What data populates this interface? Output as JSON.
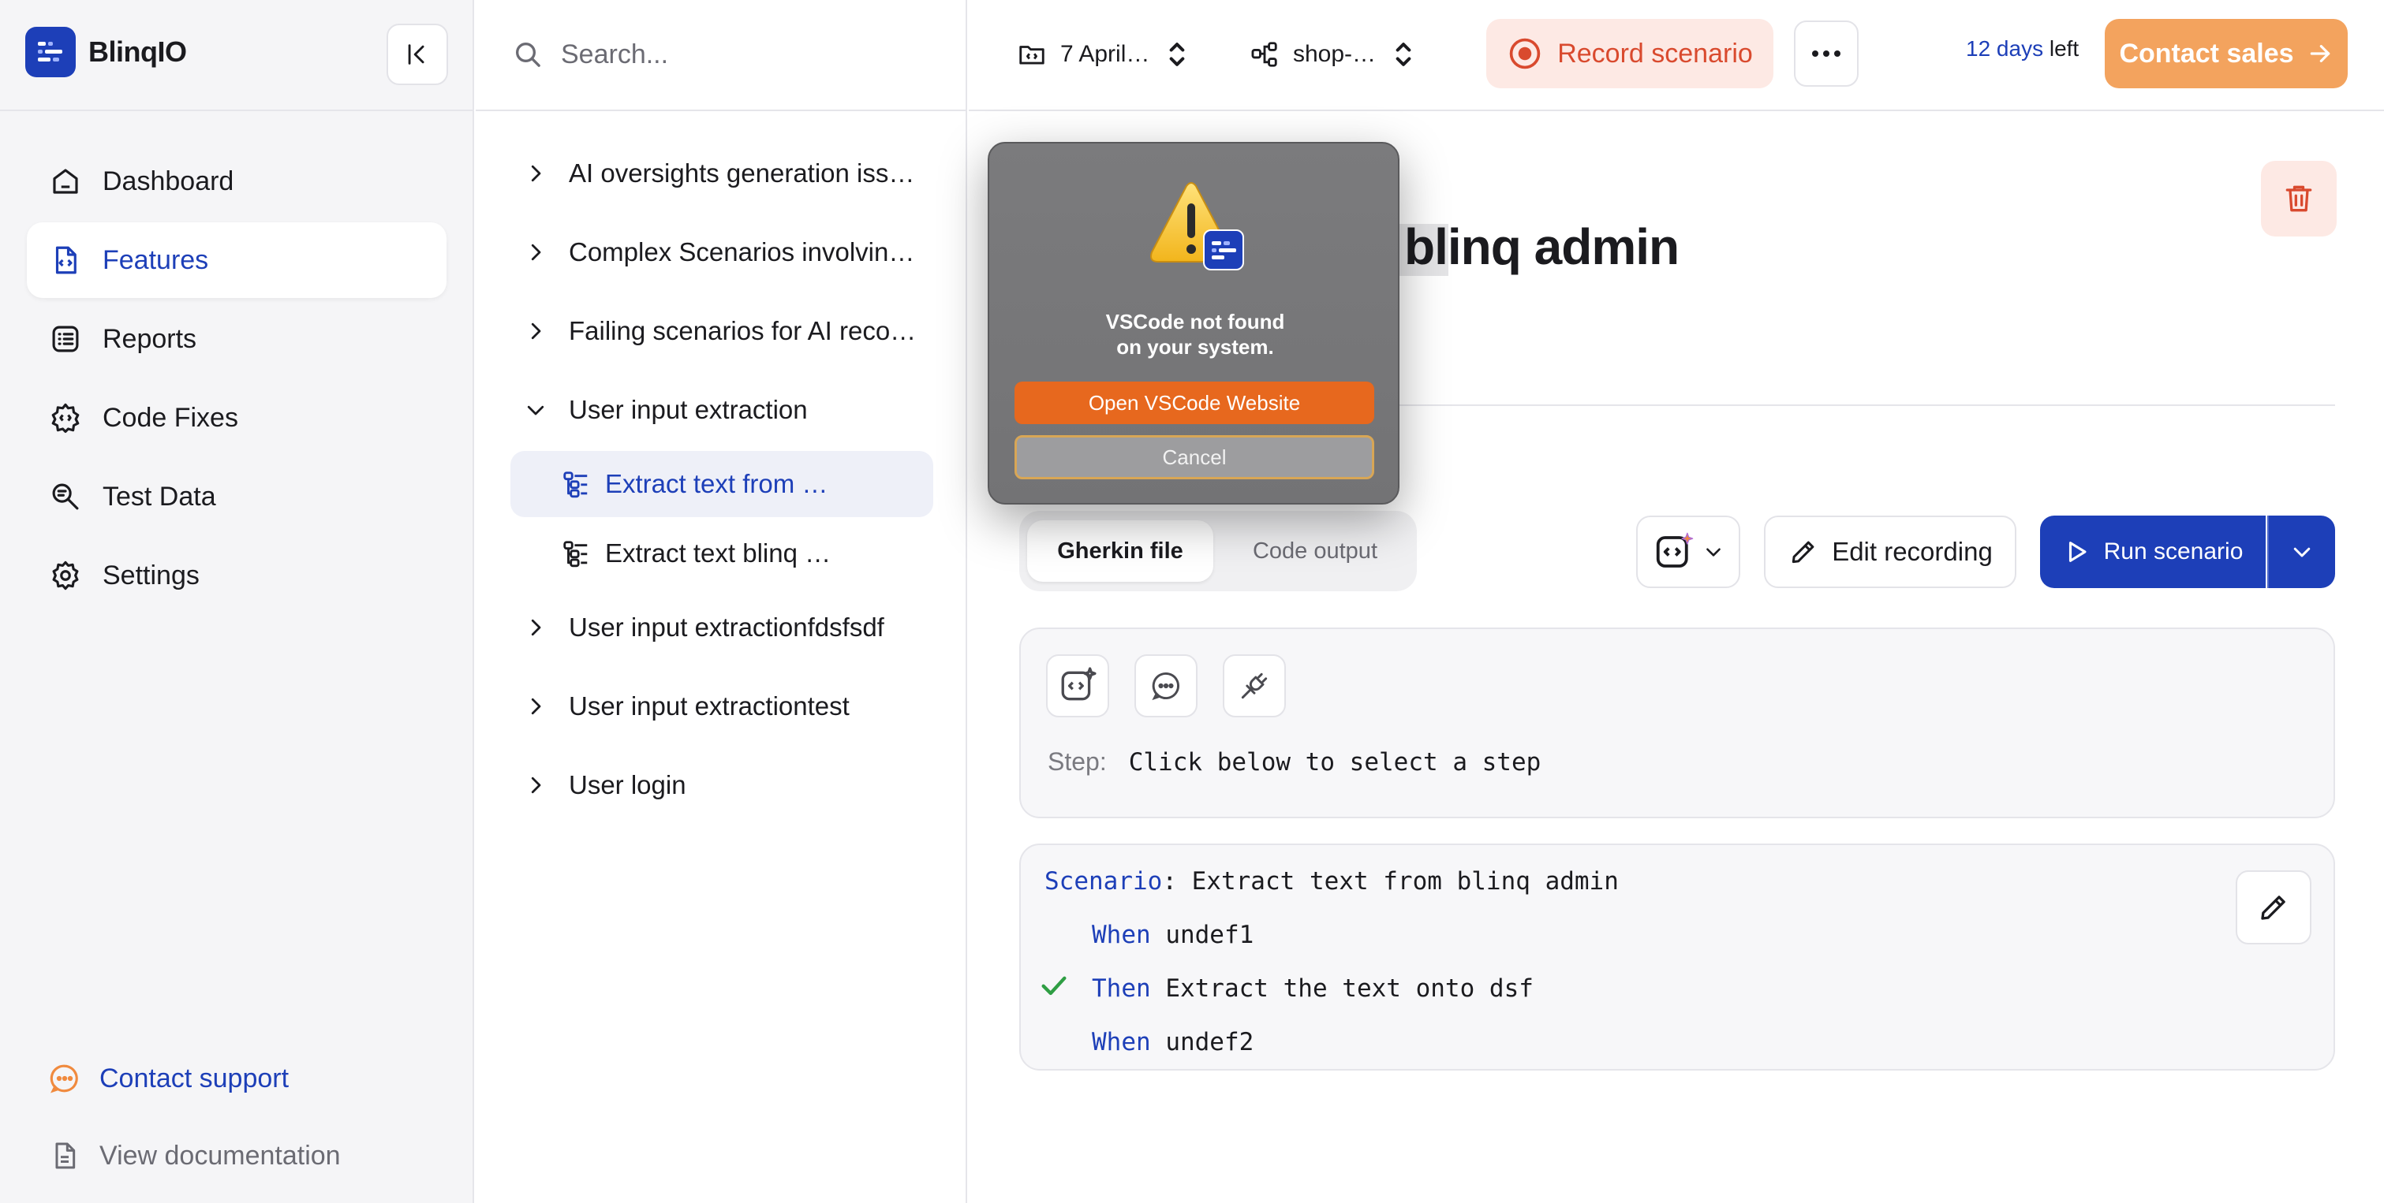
{
  "brand": {
    "name": "BlinqIO"
  },
  "nav": {
    "items": [
      {
        "label": "Dashboard",
        "icon": "home-icon"
      },
      {
        "label": "Features",
        "icon": "feature-file-icon",
        "active": true
      },
      {
        "label": "Reports",
        "icon": "list-icon"
      },
      {
        "label": "Code Fixes",
        "icon": "gear-code-icon"
      },
      {
        "label": "Test Data",
        "icon": "search-data-icon"
      },
      {
        "label": "Settings",
        "icon": "gear-icon"
      }
    ],
    "contact_support": "Contact support",
    "view_docs": "View documentation"
  },
  "search": {
    "placeholder": "Search..."
  },
  "tree": {
    "items": [
      {
        "label": "AI oversights generation iss…"
      },
      {
        "label": "Complex Scenarios involvin…"
      },
      {
        "label": "Failing scenarios for AI reco…"
      },
      {
        "label": "User input extraction",
        "expanded": true
      },
      {
        "label": "User input extractionfdsfsdf"
      },
      {
        "label": "User input extractiontest"
      },
      {
        "label": "User login"
      }
    ],
    "children": [
      {
        "label": "Extract text from …",
        "selected": true
      },
      {
        "label": "Extract text blinq …"
      }
    ]
  },
  "topbar": {
    "branch": "7 April…",
    "project": "shop-…",
    "record": "Record scenario",
    "trial_days": "12 days",
    "trial_suffix": "left",
    "contact_sales": "Contact sales"
  },
  "scenario": {
    "title": "blinq admin",
    "tabs": [
      "Gherkin file",
      "Code output"
    ],
    "edit_recording": "Edit recording",
    "run_scenario": "Run scenario",
    "step_label": "Step:",
    "step_text": "Click below to select a step"
  },
  "gherkin": {
    "scenario_kw": "Scenario",
    "scenario_name": ": Extract text from blinq admin",
    "steps": [
      {
        "kw": "When",
        "text": " undef1",
        "passed": false
      },
      {
        "kw": "Then",
        "text": " Extract the text onto dsf",
        "passed": true
      },
      {
        "kw": "When",
        "text": " undef2",
        "passed": false
      }
    ]
  },
  "alert": {
    "message": "VSCode not found on your system.",
    "primary": "Open VSCode Website",
    "cancel": "Cancel"
  },
  "colors": {
    "brand": "#1d3fb8",
    "record": "#d94a2e",
    "contact_sales": "#f3a35e",
    "alert_primary": "#e7681e",
    "pass": "#2f9e44"
  }
}
